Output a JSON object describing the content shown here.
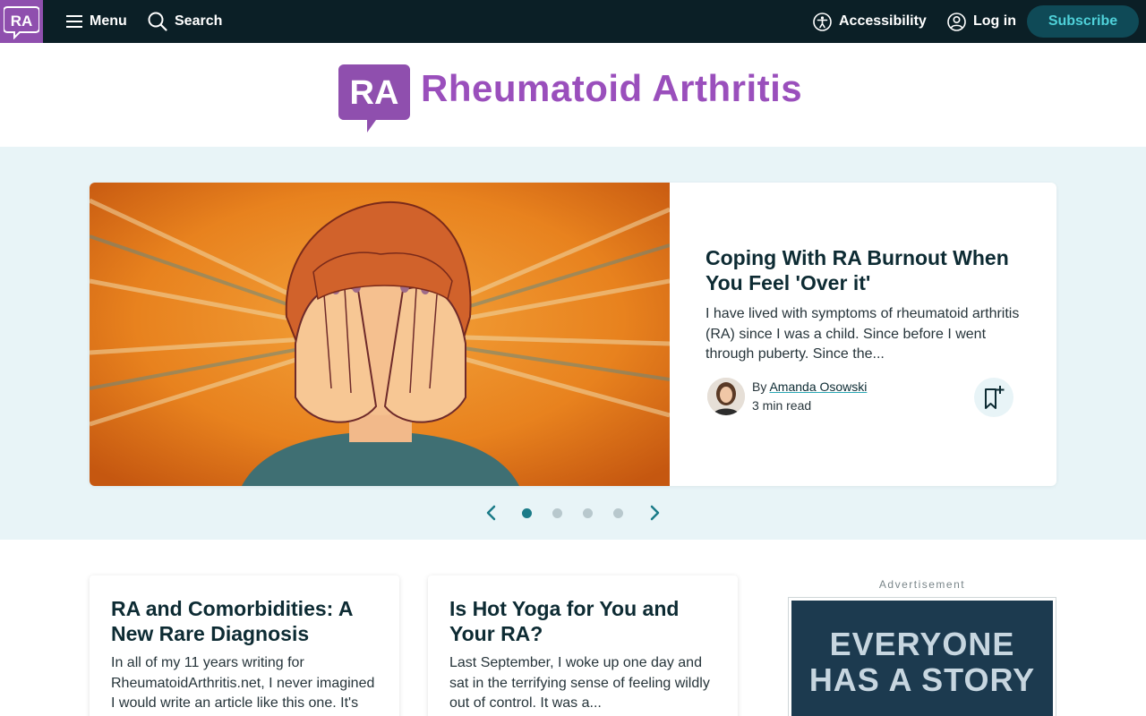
{
  "nav": {
    "logo_text": "RA",
    "menu_label": "Menu",
    "search_label": "Search",
    "accessibility_label": "Accessibility",
    "login_label": "Log in",
    "subscribe_label": "Subscribe"
  },
  "brand": {
    "logo_text": "RA",
    "name": "Rheumatoid Arthritis",
    "color": "#9a4fbc"
  },
  "hero": {
    "title": "Coping With RA Burnout When You Feel 'Over it'",
    "excerpt": "I have lived with symptoms of rheumatoid arthritis (RA) since I was a child. Since before I went through puberty. Since the...",
    "by_prefix": "By",
    "author": "Amanda Osowski",
    "read_time": "3 min read",
    "slide_count": 4,
    "active_slide": 1
  },
  "articles": [
    {
      "title": "RA and Comorbidities: A New Rare Diagnosis",
      "excerpt": "In all of my 11 years writing for RheumatoidArthritis.net, I never imagined I would write an article like this one. It's"
    },
    {
      "title": "Is Hot Yoga for You and Your RA?",
      "excerpt": "Last September, I woke up one day and sat in the terrifying sense of feeling wildly out of control. It was a..."
    }
  ],
  "ad": {
    "label": "Advertisement",
    "line1": "EVERYONE",
    "line2": "HAS A STORY"
  },
  "colors": {
    "nav_bg": "#0b1f26",
    "accent_teal": "#1b7b88",
    "hero_bg": "#e8f4f7",
    "brand_purple": "#8f4fae"
  }
}
